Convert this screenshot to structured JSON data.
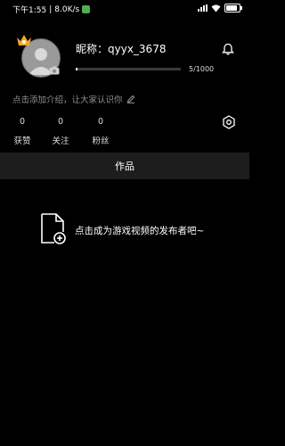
{
  "status_bar": {
    "time": "下午1:55",
    "speed": "8.0K/s",
    "battery": "98"
  },
  "profile": {
    "nickname": "昵称：qyyx_3678",
    "progress": {
      "value": 5,
      "max": 1000,
      "text": "5/1000"
    },
    "intro_prompt": "点击添加介绍，让大家认识你"
  },
  "stats": [
    {
      "count": "0",
      "label": "获赞"
    },
    {
      "count": "0",
      "label": "关注"
    },
    {
      "count": "0",
      "label": "粉丝"
    }
  ],
  "tabs": [
    {
      "label": "作品"
    }
  ],
  "empty_state": {
    "text": "点击成为游戏视频的发布者吧~"
  },
  "colors": {
    "background": "#000000",
    "tab_bar": "#1d1d1d",
    "muted_text": "#8e8e8e",
    "avatar_badge": "#f5a623"
  }
}
